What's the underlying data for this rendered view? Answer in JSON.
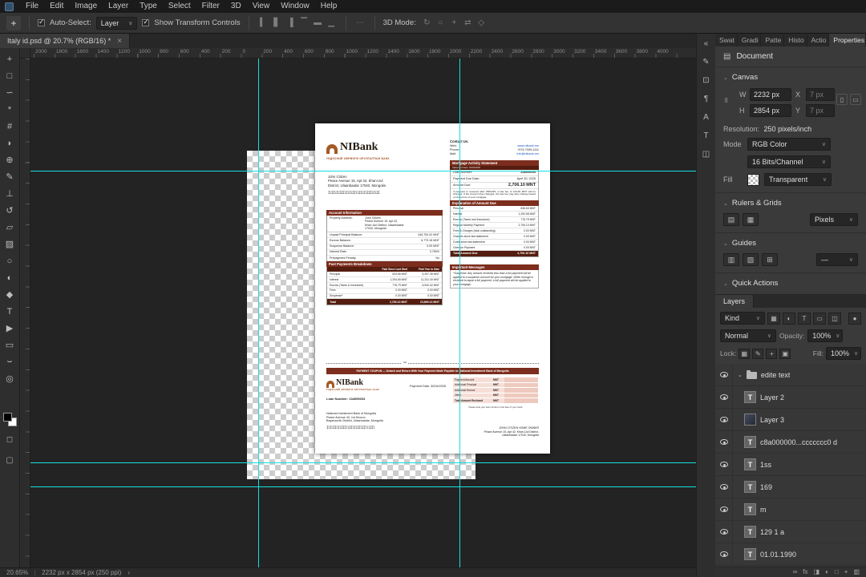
{
  "colors": {
    "maroon": "#7c2d1d",
    "dark_maroon": "#541d0f",
    "logo_brown": "#a45a24",
    "link_blue": "#1456c4",
    "guide_cyan": "#17dede",
    "coupon_pink": "#f6ded7"
  },
  "icons": {
    "close": "×",
    "chevron_down": "⌄",
    "link": "∞",
    "scissors": "✂",
    "document": "▤",
    "portrait": "▯",
    "landscape": "▭",
    "more": "⋯",
    "type_thumb": "T",
    "status_chevron": "›",
    "toggle": "●",
    "move_tool": "+"
  },
  "menubar": {
    "items": [
      "File",
      "Edit",
      "Image",
      "Layer",
      "Type",
      "Select",
      "Filter",
      "3D",
      "View",
      "Window",
      "Help"
    ]
  },
  "options": {
    "auto_select_label": "Auto-Select:",
    "target_value": "Layer",
    "transform_label": "Show Transform Controls",
    "mode3d_label": "3D Mode:",
    "align_icons": [
      {
        "name": "align-left-icon",
        "glyph": "▍"
      },
      {
        "name": "align-center-h-icon",
        "glyph": "▋"
      },
      {
        "name": "align-right-icon",
        "glyph": "▐"
      },
      {
        "name": "align-top-icon",
        "glyph": "▔"
      },
      {
        "name": "align-middle-icon",
        "glyph": "▬"
      },
      {
        "name": "align-bottom-icon",
        "glyph": "▁"
      }
    ],
    "mode3d_icons": [
      {
        "name": "3d-rotate-icon",
        "glyph": "↻"
      },
      {
        "name": "3d-roll-icon",
        "glyph": "○"
      },
      {
        "name": "3d-drag-icon",
        "glyph": "+"
      },
      {
        "name": "3d-slide-icon",
        "glyph": "⇄"
      },
      {
        "name": "3d-scale-icon",
        "glyph": "◇"
      }
    ]
  },
  "tab": {
    "title": "Italy id.psd @ 20.7% (RGB/16) *"
  },
  "ruler": {
    "labels": [
      "2000",
      "1800",
      "1600",
      "1400",
      "1200",
      "1000",
      "800",
      "600",
      "400",
      "200",
      "0",
      "200",
      "400",
      "600",
      "800",
      "1000",
      "1200",
      "1400",
      "1600",
      "1800",
      "2000",
      "2200",
      "2400",
      "2600",
      "2800",
      "3000",
      "3200",
      "3400",
      "3600",
      "3800",
      "4000"
    ]
  },
  "tools": [
    {
      "name": "move-tool",
      "glyph": "+"
    },
    {
      "name": "rectangular-marquee-tool",
      "glyph": "□"
    },
    {
      "name": "lasso-tool",
      "glyph": "∽"
    },
    {
      "name": "magic-wand-tool",
      "glyph": "*"
    },
    {
      "name": "crop-tool",
      "glyph": "#"
    },
    {
      "name": "eyedropper-tool",
      "glyph": "◗"
    },
    {
      "name": "spot-healing-brush-tool",
      "glyph": "⊕"
    },
    {
      "name": "brush-tool",
      "glyph": "✎"
    },
    {
      "name": "clone-stamp-tool",
      "glyph": "⊥"
    },
    {
      "name": "history-brush-tool",
      "glyph": "↺"
    },
    {
      "name": "eraser-tool",
      "glyph": "▱"
    },
    {
      "name": "gradient-tool",
      "glyph": "▨"
    },
    {
      "name": "blur-tool",
      "glyph": "○"
    },
    {
      "name": "dodge-tool",
      "glyph": "◐"
    },
    {
      "name": "pen-tool",
      "glyph": "◆"
    },
    {
      "name": "horizontal-type-tool",
      "glyph": "T"
    },
    {
      "name": "path-selection-tool",
      "glyph": "▶"
    },
    {
      "name": "rectangle-tool",
      "glyph": "▭"
    },
    {
      "name": "hand-tool",
      "glyph": "⌣"
    },
    {
      "name": "zoom-tool",
      "glyph": "◎"
    }
  ],
  "strip_icons": [
    {
      "name": "collapse-panels-icon",
      "glyph": "«"
    },
    {
      "name": "brush-settings-icon",
      "glyph": "✎"
    },
    {
      "name": "clone-source-icon",
      "glyph": "⊡"
    },
    {
      "name": "paragraph-icon",
      "glyph": "¶"
    },
    {
      "name": "character-icon",
      "glyph": "A"
    },
    {
      "name": "glyphs-icon",
      "glyph": "T"
    },
    {
      "name": "libraries-icon",
      "glyph": "◫"
    }
  ],
  "panels": {
    "tabs": [
      "Swat",
      "Gradi",
      "Patte",
      "Histo",
      "Actio",
      "Properties"
    ],
    "properties": {
      "panel_title": "Document",
      "canvas_section": "Canvas",
      "w_label": "W",
      "w_value": "2232 px",
      "x_label": "X",
      "x_value": "7 px",
      "h_label": "H",
      "h_value": "2854 px",
      "y_label": "Y",
      "y_value": "7 px",
      "resolution_label": "Resolution:",
      "resolution_value": "250 pixels/inch",
      "mode_label": "Mode",
      "mode_value": "RGB Color",
      "depth_value": "16 Bits/Channel",
      "fill_label": "Fill",
      "fill_value": "Transparent",
      "rulers_section": "Rulers & Grids",
      "units_value": "Pixels",
      "ruler_icons": [
        {
          "name": "ruler-icon",
          "glyph": "▤"
        },
        {
          "name": "grid-icon",
          "glyph": "▦"
        }
      ],
      "guides_section": "Guides",
      "guides_value": "—",
      "guides_icons": [
        {
          "name": "guides-icon",
          "glyph": "▥"
        },
        {
          "name": "smart-guides-icon",
          "glyph": "▨"
        },
        {
          "name": "clear-guides-icon",
          "glyph": "⊞"
        }
      ],
      "quick_section": "Quick Actions"
    },
    "layers": {
      "tab": "Layers",
      "kind": "Kind",
      "filter_icons": [
        {
          "name": "filter-pixel-layers-icon",
          "glyph": "▦"
        },
        {
          "name": "filter-adjustment-layers-icon",
          "glyph": "◐"
        },
        {
          "name": "filter-type-layers-icon",
          "glyph": "T"
        },
        {
          "name": "filter-shape-layers-icon",
          "glyph": "▭"
        },
        {
          "name": "filter-smart-objects-icon",
          "glyph": "◫"
        }
      ],
      "blend": "Normal",
      "opacity_label": "Opacity:",
      "opacity": "100%",
      "lock_label": "Lock:",
      "lock_icons": [
        {
          "name": "lock-transparency-icon",
          "glyph": "▦"
        },
        {
          "name": "lock-pixels-icon",
          "glyph": "✎"
        },
        {
          "name": "lock-position-icon",
          "glyph": "+"
        },
        {
          "name": "lock-all-icon",
          "glyph": "▣"
        }
      ],
      "fill_label": "Fill:",
      "fill": "100%",
      "items": [
        {
          "label": "edite text"
        },
        {
          "label": "Layer 2"
        },
        {
          "label": "Layer 3"
        },
        {
          "label": "c8a000000...ccccccc0 d"
        },
        {
          "label": "1ss"
        },
        {
          "label": "169"
        },
        {
          "label": "m"
        },
        {
          "label": "129 1 a"
        },
        {
          "label": "01.01.1990"
        }
      ],
      "footer_icons": [
        {
          "name": "link-layers-icon",
          "glyph": "∞"
        },
        {
          "name": "layer-effects-icon",
          "glyph": "fx"
        },
        {
          "name": "layer-mask-icon",
          "glyph": "◨"
        },
        {
          "name": "adjustment-layer-icon",
          "glyph": "◐"
        },
        {
          "name": "layer-group-icon",
          "glyph": "□"
        },
        {
          "name": "new-layer-icon",
          "glyph": "+"
        },
        {
          "name": "delete-layer-icon",
          "glyph": "▥"
        }
      ]
    }
  },
  "statusbar": {
    "zoom": "20.65%",
    "doc_info": "2232 px x 2854 px (250 ppi)"
  },
  "doc": {
    "logo": {
      "name": "NIBank",
      "tagline": "ҮНДЭСНИЙ ХӨРӨНГӨ ОРУУЛАЛТЫН БАНК"
    },
    "contact": {
      "title": "Contact Us:",
      "web_label": "Web:",
      "web": "www.nibank.mn",
      "phone_label": "Phone:",
      "phone": "+976 7009-1111",
      "mail_label": "Mail:",
      "mail": "info@nibank.mn"
    },
    "statement": {
      "header": "Mortgage Activity Statement",
      "subheader": "Statement Date: 04/04/2025",
      "loan_label": "Loan Number:",
      "loan_value": "134695203",
      "due_label": "Payment Due Date:",
      "due_value": "April 30, 2025",
      "amount_label": "Amount Due:",
      "amount_value": "2,706.10 MNT",
      "note": "If payment is received after 05/04/25, a late fee of 134.46 MNT will be charged. If the Amount Due changed, the late fee may also change based on the terms of your mortgage."
    },
    "recipient": {
      "lines": [
        "John Citizen",
        "Peace Avenue 15, Apt 42, Khan-Uul",
        "District, Ulaanbaatar 17040, Mongolia"
      ],
      "barcode": "IlIIlIlIIIlIlIlIIllIIlIlIIIlIlII"
    },
    "account": {
      "header": "Account Information",
      "property_label": "Property Address:",
      "property_lines": [
        "John Citizen",
        "Peace Avenue 15, Apt 42,",
        "Khan-Uul District, Ulaanbaatar",
        "17040, Mongolia"
      ],
      "rows": [
        [
          "Unpaid Principal Balance:",
          "445,752.02 MNT"
        ],
        [
          "Escrow Balance:",
          "6,779.18 MNT"
        ],
        [
          "Suspense Balance:",
          "0.00 MNT"
        ],
        [
          "Interest Rate:",
          "3.750%"
        ],
        [
          "Prepayment Penalty:",
          "No"
        ]
      ]
    },
    "explanation": {
      "header": "Explanation of Amount Due",
      "rows": [
        [
          "Principal",
          "636.63 MNT"
        ],
        [
          "Interest",
          "1,292.68 MNT"
        ],
        [
          "Escrow (Taxes and Insurance)",
          "776.79 MNT"
        ],
        [
          "Regular Monthly Payment",
          "2,706.10 MNT"
        ],
        [
          "Fees & Charges (total outstanding)",
          "0.00 MNT"
        ],
        [
          "Charges since last statement",
          "0.00 MNT"
        ],
        [
          "Costs since last statement",
          "0.00 MNT"
        ],
        [
          "Overdue Payment",
          "0.00 MNT"
        ]
      ],
      "total": [
        "Total Amount Due",
        "2,706.10 MNT"
      ]
    },
    "past": {
      "header": "Past Payments Breakdown",
      "columns": [
        "",
        "Paid Since Last Stmt",
        "Paid Year to Date"
      ],
      "rows": [
        [
          "Principal",
          "634.66 MNT",
          "5,497.38 MNT"
        ],
        [
          "Interest",
          "1,294.65 MNT",
          "11,231.40 MNT"
        ],
        [
          "Escrow (Taxes & Insurance)",
          "776.79 MNT",
          "6,940.32 MNT"
        ],
        [
          "Fees",
          "0.00 MNT",
          "0.00 MNT"
        ],
        [
          "Suspense*",
          "0.00 MNT",
          "0.00 MNT"
        ]
      ],
      "total": [
        "Total",
        "2,706.10 MNT",
        "23,669.10 MNT"
      ]
    },
    "messages": {
      "header": "Important Messages",
      "body": "*Suspense: Any amount received less than a full payment will be applied to a suspense account for your mortgage. When enough is received to equal a full payment, a full payment will be applied to your mortgage."
    },
    "coupon": {
      "bar": "PAYMENT COUPON — Detach and Return With Your Payment Made Payable to: National Investment Bank of Mongolia",
      "payment_date": "Payment Date: 30/04/2025",
      "loan": "Loan Number: 134695203",
      "fields": [
        [
          "Payment Amount",
          "MNT"
        ],
        [
          "Additional Principal",
          "MNT"
        ],
        [
          "Additional Escrow",
          "MNT"
        ],
        [
          "Other",
          "MNT"
        ],
        [
          "Total Amount Enclosed",
          "MNT"
        ]
      ],
      "fields_note": "Please write your loan number on the face of your check",
      "bank_lines": [
        "National Investment Bank of Mongolia",
        "Peace Avenue 43, 1st Khoroo",
        "Bayanzurkh District, Ulaanbaatar, Mongolia"
      ],
      "bank_barcode": "IlIlIIlIlIIIllIIlIlIIlIIlllIIl",
      "owner_lines": [
        "JOHN CITIZEN HOME OWNER",
        "Peace Avenue 15, Apt 42, Khan-Uul District,",
        "Ulaanbaatar 17040, Mongolia"
      ]
    }
  }
}
